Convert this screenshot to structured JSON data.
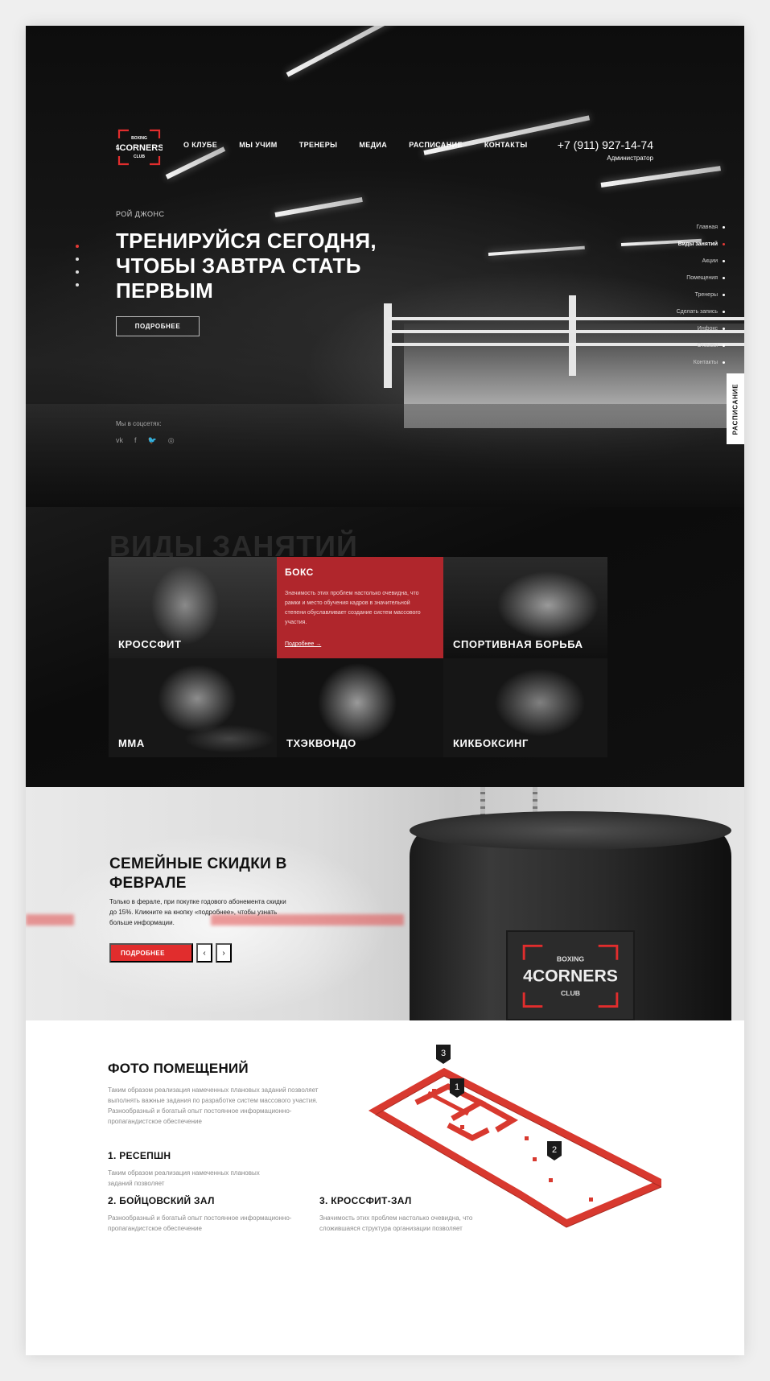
{
  "header": {
    "logo_text": "4CORNERS",
    "logo_top": "BOXING",
    "logo_bottom": "CLUB",
    "nav": [
      "О КЛУБЕ",
      "МЫ УЧИМ",
      "ТРЕНЕРЫ",
      "МЕДИА",
      "РАСПИСАНИЕ",
      "КОНТАКТЫ"
    ],
    "phone": "+7 (911) 927-14-74",
    "phone_caption": "Администратор"
  },
  "hero": {
    "eyebrow": "РОЙ ДЖОНС",
    "title": "ТРЕНИРУЙСЯ СЕГОДНЯ, ЧТОБЫ ЗАВТРА СТАТЬ ПЕРВЫМ",
    "cta": "ПОДРОБНЕЕ",
    "social_label": "Мы в соцсетях:",
    "social": [
      "vk",
      "f",
      "🐦",
      "◎"
    ],
    "side_nav": [
      "Главная",
      "Виды занятий",
      "Акции",
      "Помещения",
      "Тренеры",
      "Сделать запись",
      "Инфокс",
      "Отзывы",
      "Контакты"
    ],
    "side_nav_active": 1,
    "schedule_tab": "РАСПИСАНИЕ"
  },
  "types": {
    "title": "ВИДЫ ЗАНЯТИЙ",
    "tiles": [
      {
        "label": "КРОССФИТ"
      },
      {
        "label": "БОКС",
        "text": "Значимость этих проблем настолько очевидна, что рамки и место обучения кадров в значительной степени обуславливает создание систем массового участия.",
        "more": "Подробнее  →"
      },
      {
        "label": "СПОРТИВНАЯ БОРЬБА"
      },
      {
        "label": "ММА"
      },
      {
        "label": "ТХЭКВОНДО"
      },
      {
        "label": "КИКБОКСИНГ"
      }
    ]
  },
  "promo": {
    "title": "СЕМЕЙНЫЕ СКИДКИ В ФЕВРАЛЕ",
    "text": "Только в ферале, при покупке годового абонемента скидки до 15%. Кликните на кнопку «подробнее», чтобы узнать больше информации.",
    "cta": "ПОДРОБНЕЕ",
    "prev": "‹",
    "next": "›",
    "patch_top": "BOXING",
    "patch_main": "4CORNERS",
    "patch_bottom": "CLUB"
  },
  "rooms": {
    "title": "ФОТО ПОМЕЩЕНИЙ",
    "intro": "Таким образом реализация намеченных плановых заданий позволяет выполнять важные задания по разработке систем массового участия. Разнообразный и богатый опыт постоянное информационно-пропагандистское обеспечение",
    "items": [
      {
        "title": "1. РЕСЕПШН",
        "text": "Таким образом реализация намеченных плановых заданий позволяет"
      },
      {
        "title": "2. БОЙЦОВСКИЙ ЗАЛ",
        "text": "Разнообразный и богатый опыт постоянное информационно-пропагандистское обеспечение"
      },
      {
        "title": "3. КРОССФИТ-ЗАЛ",
        "text": "Значимость этих проблем настолько очевидна, что сложившаяся структура организации позволяет"
      }
    ],
    "markers": [
      "1",
      "2",
      "3"
    ]
  },
  "colors": {
    "accent": "#e12d2d",
    "boxing_tile": "#b0262c",
    "dark": "#111111"
  }
}
